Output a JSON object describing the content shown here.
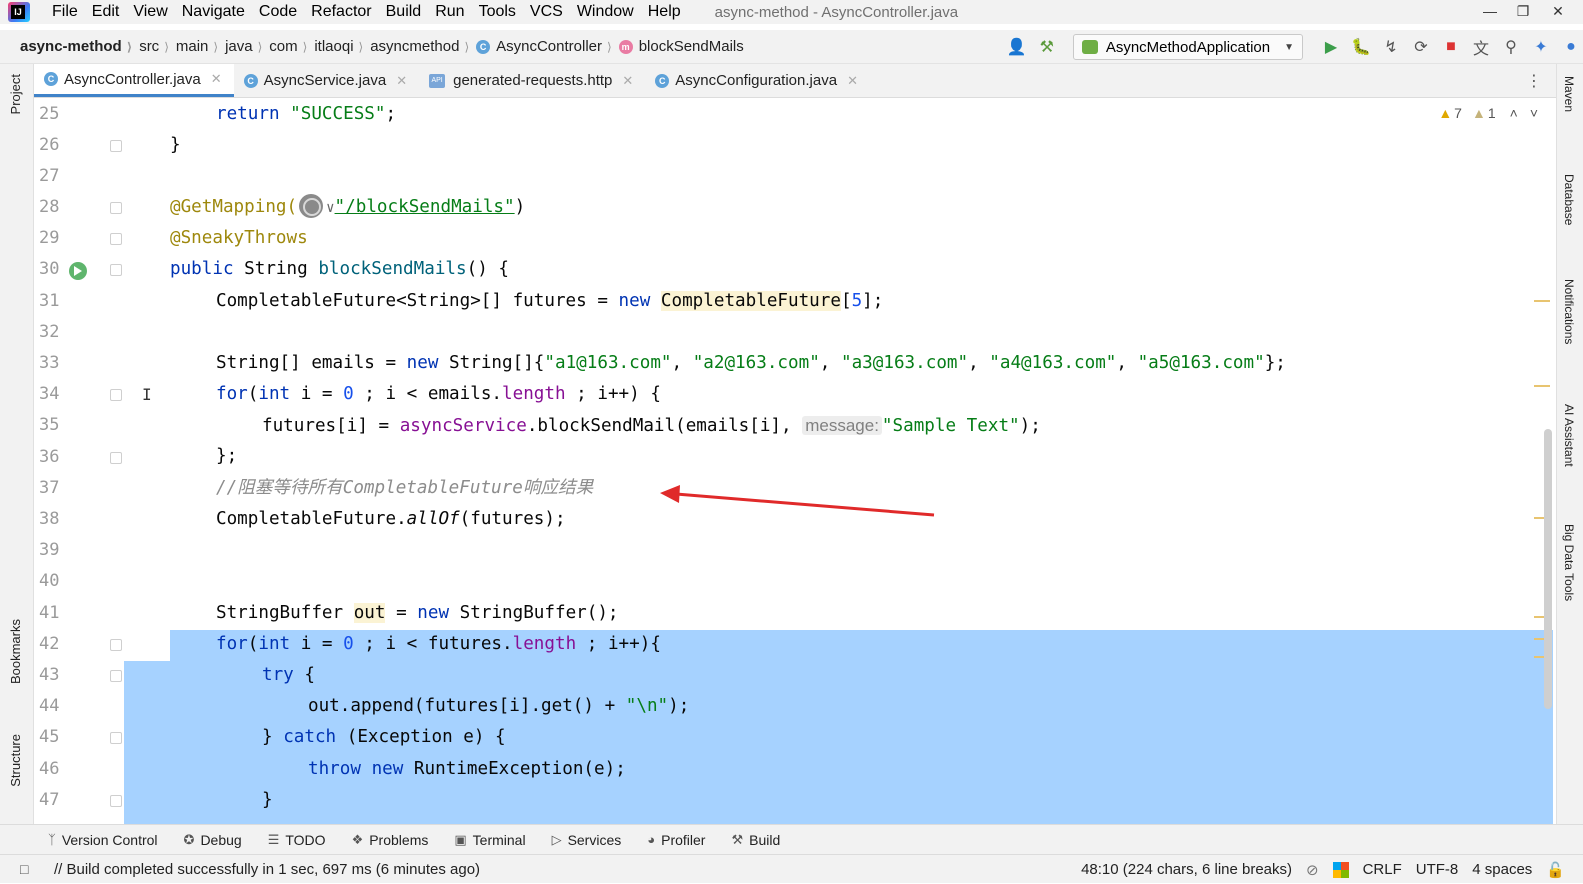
{
  "menu": {
    "items": [
      "File",
      "Edit",
      "View",
      "Navigate",
      "Code",
      "Refactor",
      "Build",
      "Run",
      "Tools",
      "VCS",
      "Window",
      "Help"
    ],
    "window_title": "async-method - AsyncController.java"
  },
  "breadcrumbs": [
    "async-method",
    "src",
    "main",
    "java",
    "com",
    "itlaoqi",
    "asyncmethod",
    "AsyncController",
    "blockSendMails"
  ],
  "run_config": "AsyncMethodApplication",
  "side_left": [
    "Project",
    "Bookmarks",
    "Structure"
  ],
  "side_right": [
    "Maven",
    "Database",
    "Notifications",
    "AI Assistant",
    "Big Data Tools"
  ],
  "tabs": [
    {
      "label": "AsyncController.java",
      "active": true
    },
    {
      "label": "AsyncService.java",
      "active": false
    },
    {
      "label": "generated-requests.http",
      "active": false
    },
    {
      "label": "AsyncConfiguration.java",
      "active": false
    }
  ],
  "warnings": {
    "warn_count": "7",
    "weak_count": "1"
  },
  "line_numbers": [
    "25",
    "26",
    "27",
    "28",
    "29",
    "30",
    "31",
    "32",
    "33",
    "34",
    "35",
    "36",
    "37",
    "38",
    "39",
    "40",
    "41",
    "42",
    "43",
    "44",
    "45",
    "46",
    "47"
  ],
  "code": {
    "l25_kw": "return",
    "l25_str": "\"SUCCESS\"",
    "l25_end": ";",
    "l26": "}",
    "l28_ann": "@GetMapping(",
    "l28_str": "\"/blockSendMails\"",
    "l28_end": ")",
    "l29_ann": "@SneakyThrows",
    "l30_kw": "public",
    "l30_type": " String ",
    "l30_name": "blockSendMails",
    "l30_end": "() {",
    "l31_a": "CompletableFuture<String>[] futures = ",
    "l31_kw": "new",
    "l31_hl": "CompletableFuture",
    "l31_b": "[",
    "l31_num": "5",
    "l31_c": "];",
    "l33_a": "String[] emails = ",
    "l33_kw": "new",
    "l33_b": " String[]{",
    "l33_s1": "\"a1@163.com\"",
    "l33_s2": "\"a2@163.com\"",
    "l33_s3": "\"a3@163.com\"",
    "l33_s4": "\"a4@163.com\"",
    "l33_s5": "\"a5@163.com\"",
    "l33_end": "};",
    "l34_kw": "for",
    "l34_a": "(",
    "l34_int": "int",
    "l34_b": " i = ",
    "l34_num": "0",
    "l34_c": " ; i < emails.",
    "l34_fld": "length",
    "l34_d": " ; i++) {",
    "l35_a": "futures[i] = ",
    "l35_fld": "asyncService",
    "l35_b": ".blockSendMail(emails[i], ",
    "l35_hint": "message:",
    "l35_str": "\"Sample Text\"",
    "l35_end": ");",
    "l36": "};",
    "l37_cmt": "//阻塞等待所有CompletableFuture响应结果",
    "l38_a": "CompletableFuture.",
    "l38_it": "allOf",
    "l38_b": "(futures);",
    "l41_a": "StringBuffer ",
    "l41_hl": "out",
    "l41_b": " = ",
    "l41_kw": "new",
    "l41_c": " StringBuffer();",
    "l42_kw": "for",
    "l42_a": "(",
    "l42_int": "int",
    "l42_b": " i = ",
    "l42_num": "0",
    "l42_c": " ; i < futures.",
    "l42_fld": "length",
    "l42_d": " ; i++){",
    "l43_kw": "try",
    "l43_a": " {",
    "l44_a": "out.append(futures[i].get() + ",
    "l44_str": "\"\\n\"",
    "l44_b": ");",
    "l45_a": "} ",
    "l45_kw": "catch",
    "l45_b": " (Exception e) {",
    "l46_kw1": "throw",
    "l46_kw2": "new",
    "l46_a": " RuntimeException(e);",
    "l47": "}"
  },
  "bottom_tools": [
    "Version Control",
    "Debug",
    "TODO",
    "Problems",
    "Terminal",
    "Services",
    "Profiler",
    "Build"
  ],
  "status": {
    "message": "// Build completed successfully in 1 sec, 697 ms (6 minutes ago)",
    "position": "48:10 (224 chars, 6 line breaks)",
    "line_sep": "CRLF",
    "encoding": "UTF-8",
    "indent": "4 spaces"
  },
  "colors": {
    "selection": "#a6d2ff",
    "keyword": "#0033b3",
    "string": "#067d17",
    "annotation": "#9e880d",
    "arrow": "#e02a2a"
  }
}
